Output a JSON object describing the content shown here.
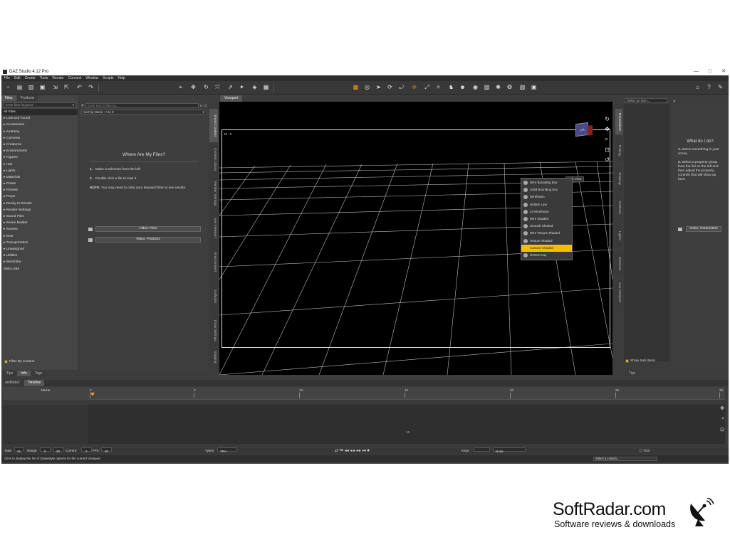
{
  "app": {
    "title": "DAZ Studio 4.12 Pro",
    "window_controls": [
      "—",
      "□",
      "✕"
    ]
  },
  "menubar": [
    "File",
    "Edit",
    "Create",
    "Tools",
    "Render",
    "Connect",
    "Window",
    "Scripts",
    "Help"
  ],
  "left_panel": {
    "tabs": [
      "Files",
      "Products"
    ],
    "login_label": "Login",
    "filter_placeholder": "Enter filter keyword",
    "categories": [
      "All Files",
      "▸ Lost and Found",
      "▸ Accessories",
      "▸ Anatomy",
      "▸ Cameras",
      "▸ Creatures",
      "▸ Environments",
      "▸ Figures",
      "▸ Hair",
      "▸ Lights",
      "▸ Materials",
      "▸ Poses",
      "▸ Presets",
      "▸ Props",
      "▸ Ready to Render",
      "▸ Render-Settings",
      "▸ Saved Files",
      "▸ Scene Builder",
      "▸ Scenes",
      "▸ Sets",
      "▸ Transportation",
      "▸ Unassigned",
      "▸ Utilities",
      "▸ Wardrobe",
      "Web Links"
    ],
    "filter_by_context": "Filter By Context",
    "bottom_tabs": [
      "Tips",
      "Info",
      "Tags"
    ]
  },
  "middle_panel": {
    "search_placeholder": "Enter text to filter by...",
    "page_count": "0 - 0",
    "sort_label": "Sort by Name : A to Z",
    "help_title": "Where Are My Files?",
    "step1_num": "1.",
    "step1": "Make a selection from the left.",
    "step2_num": "2.",
    "step2": "Double-click a file to load it.",
    "note_label": "NOTE:",
    "note": "You may need to clear your keyword filter to see results.",
    "video_files": "Video: Files",
    "video_products": "Video: Products"
  },
  "left_vertical_tabs": [
    "Smart Content",
    "Content Library",
    "Render Settings",
    "Aux Viewport",
    "Environment",
    "Surfaces",
    "Draw Settings",
    "Shaping"
  ],
  "viewport": {
    "tab_label": "Viewport",
    "aspect_label": "16 : 9",
    "view_dropdown": "Left View",
    "cube_label": "Left"
  },
  "draw_menu": {
    "items": [
      "Wire Bounding Box",
      "Solid Bounding Box",
      "Wireframe",
      "Hidden Line",
      "Lit Wireframe",
      "Wire Shaded",
      "Smooth Shaded",
      "Wire Texture Shaded",
      "Texture Shaded",
      "Cartoon Shaded",
      "NVIDIA Iray"
    ],
    "selected": "Cartoon Shaded"
  },
  "right_vertical_tabs": [
    "Parameters",
    "Posing",
    "Shaping",
    "Surfaces",
    "Lights",
    "Cameras",
    "Aux Viewport"
  ],
  "scene_panel": {
    "select_label": "Select an Item...",
    "show_sub_items": "Show Sub Items",
    "tips": "Tips"
  },
  "params_panel": {
    "title": "What do I do?",
    "step1_num": "1.",
    "step1": "Select something in your scene.",
    "step2_num": "2.",
    "step2": "Select a property group from the list on the left and then adjust the property controls that will show up here.",
    "video_button": "Video: Parameters"
  },
  "timeline": {
    "tabs": [
      "aniMate2",
      "Timeline"
    ],
    "name_header": "Name",
    "ticks": [
      "0",
      "5",
      "10",
      "15",
      "20",
      "25",
      "30"
    ],
    "row_label": "15",
    "total_label": "Total:",
    "total_value": "31",
    "range_label": "Range:",
    "range_start": "0",
    "range_end": "30",
    "current_label": "Current:",
    "current_value": "0",
    "fps_label": "FPS:",
    "fps_value": "30",
    "types_label": "Types:",
    "types_value": "TRA",
    "keys_label": "Keys:",
    "node_value": "Node",
    "tcb_label": "TCB"
  },
  "status": {
    "hint": "Click to display the list of DrawStyle options for the current Viewport.",
    "lesson_placeholder": "Select a Lesson..."
  },
  "brand": {
    "name": "SoftRadar.com",
    "tagline": "Software reviews & downloads"
  },
  "colors": {
    "accent": "#f0c000",
    "toolbar_icon_orange": "#f0a020",
    "panel_bg": "#3c3c3c",
    "viewport_bg": "#000000"
  }
}
